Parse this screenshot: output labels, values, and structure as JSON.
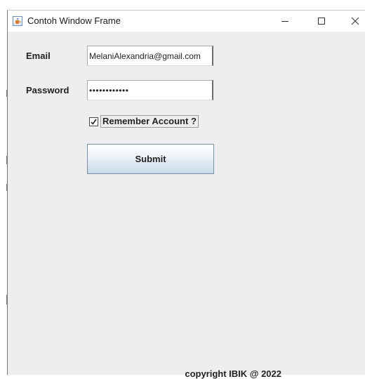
{
  "window": {
    "title": "Contoh Window Frame"
  },
  "form": {
    "email_label": "Email",
    "email_value": "MelaniAlexandria@gmail.com",
    "password_label": "Password",
    "password_value": "••••••••••••",
    "remember_label": "Remember Account ?",
    "remember_checked": true,
    "submit_label": "Submit"
  },
  "footer": {
    "text": "copyright IBIK @ 2022"
  },
  "colors": {
    "window_bg": "#eeeeee",
    "titlebar_bg": "#ffffff",
    "button_gradient_bottom": "#c9d9ea"
  },
  "icons": {
    "app": "java-cup-icon",
    "minimize": "minimize-icon",
    "maximize": "maximize-icon",
    "close": "close-icon"
  }
}
